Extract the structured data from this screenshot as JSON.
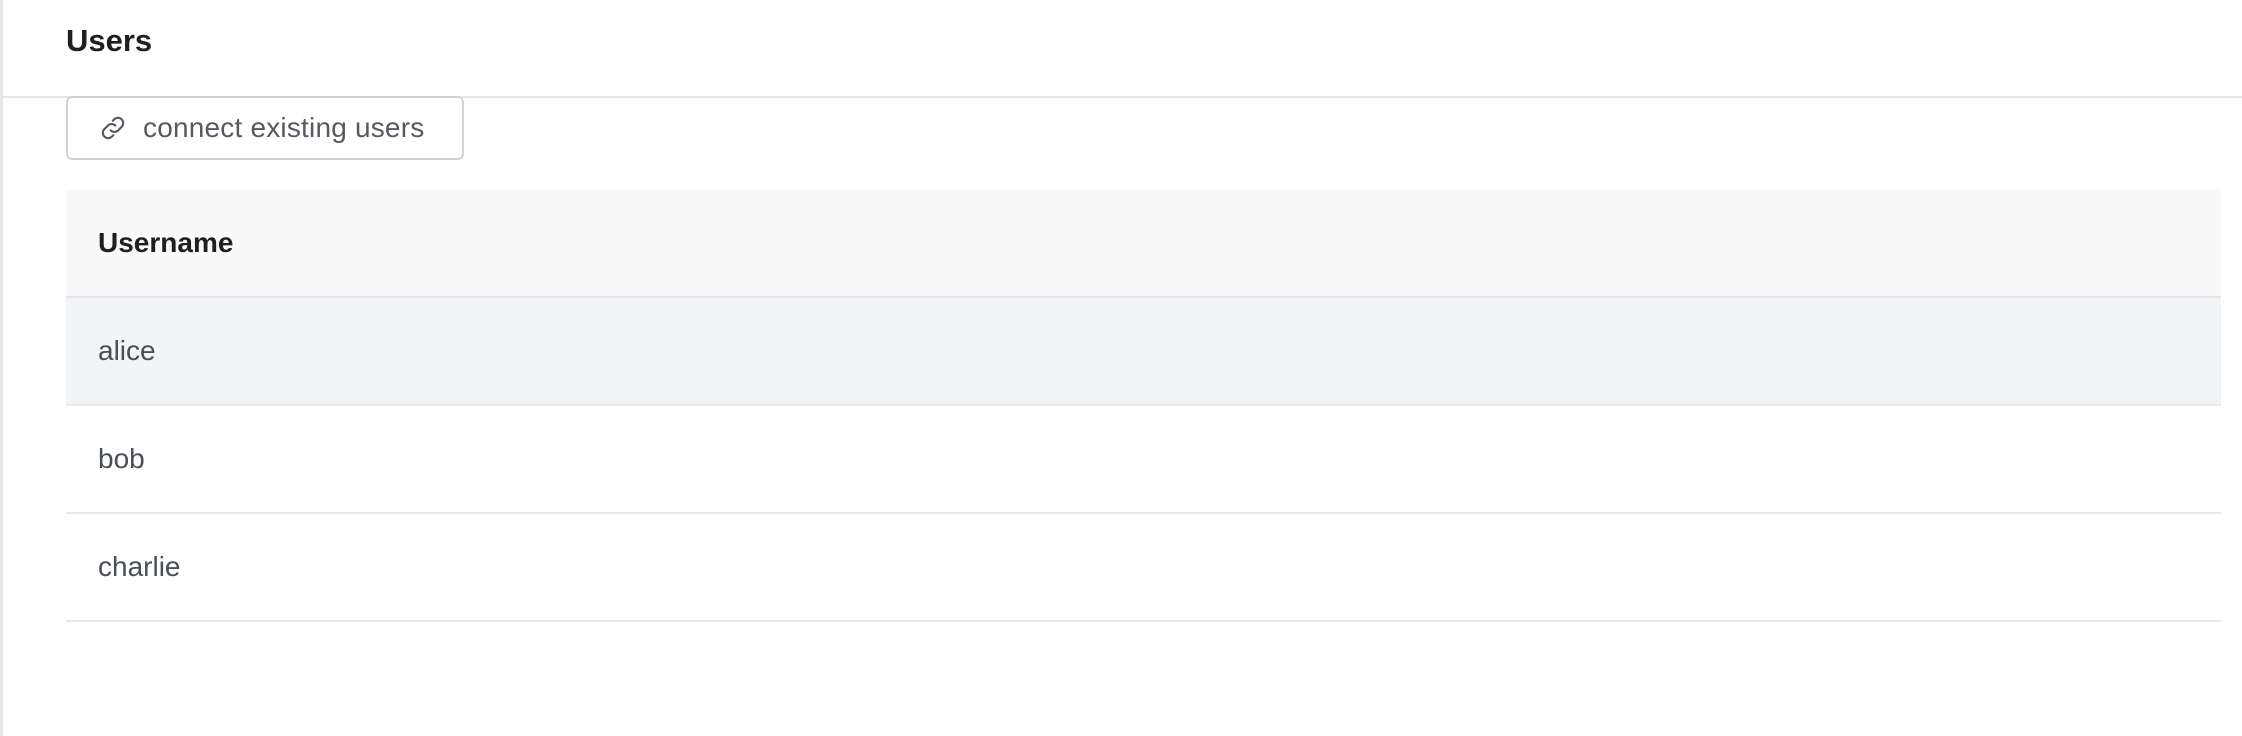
{
  "header": {
    "title": "Users"
  },
  "toolbar": {
    "connect_label": "connect existing users",
    "connect_icon": "link-icon"
  },
  "table": {
    "columns": [
      "Username"
    ],
    "rows": [
      {
        "username": "alice",
        "highlighted": true
      },
      {
        "username": "bob",
        "highlighted": false
      },
      {
        "username": "charlie",
        "highlighted": false
      }
    ]
  },
  "colors": {
    "highlight_row": "#f3f4f8",
    "header_bg": "#f9f9f9",
    "border": "#e6e6e6"
  }
}
